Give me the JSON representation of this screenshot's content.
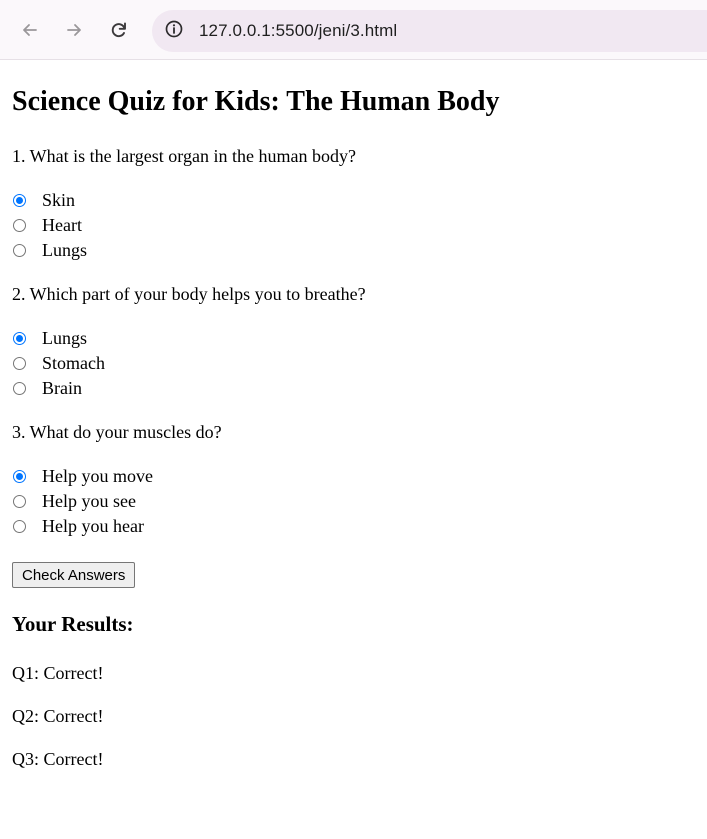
{
  "browser": {
    "url": "127.0.0.1:5500/jeni/3.html",
    "icons": {
      "back": "arrow-left-icon",
      "forward": "arrow-right-icon",
      "reload": "reload-icon",
      "site_info": "info-icon"
    }
  },
  "page": {
    "title": "Science Quiz for Kids: The Human Body",
    "questions": [
      {
        "text": "1. What is the largest organ in the human body?",
        "options": [
          {
            "label": "Skin",
            "checked": true
          },
          {
            "label": "Heart",
            "checked": false
          },
          {
            "label": "Lungs",
            "checked": false
          }
        ]
      },
      {
        "text": "2. Which part of your body helps you to breathe?",
        "options": [
          {
            "label": "Lungs",
            "checked": true
          },
          {
            "label": "Stomach",
            "checked": false
          },
          {
            "label": "Brain",
            "checked": false
          }
        ]
      },
      {
        "text": "3. What do your muscles do?",
        "options": [
          {
            "label": "Help you move",
            "checked": true
          },
          {
            "label": "Help you see",
            "checked": false
          },
          {
            "label": "Help you hear",
            "checked": false
          }
        ]
      }
    ],
    "check_button_label": "Check Answers",
    "results_heading": "Your Results:",
    "results": [
      "Q1: Correct!",
      "Q2: Correct!",
      "Q3: Correct!"
    ]
  },
  "colors": {
    "radio_checked": "#0075ff",
    "toolbar_bg": "#fbf8fb",
    "omnibox_bg": "#f1e8f2"
  }
}
